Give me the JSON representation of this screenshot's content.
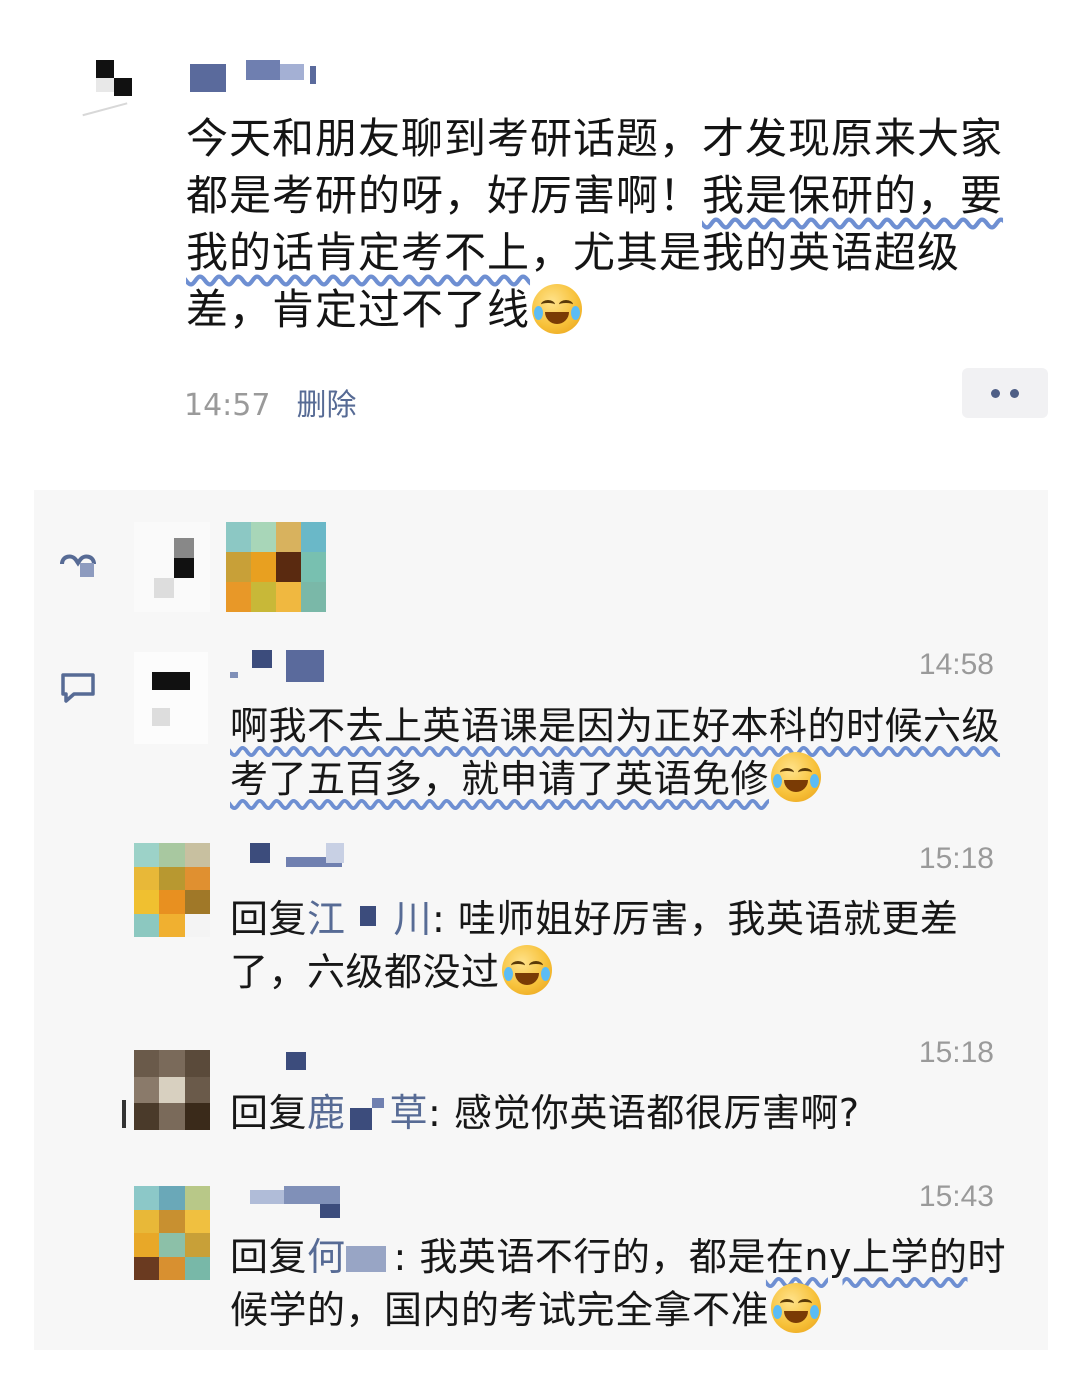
{
  "post": {
    "avatar_icon": "pixelated-avatar",
    "text_before": "今天和朋友聊到考研话题，才发现原来大家都是考研的呀，好厉害啊！",
    "text_under": "我是保研的，要我的话肯定考不上",
    "text_after": "，尤其是我的英语超级差，肯定过不了线",
    "emoji": "facepalm-emoji",
    "time": "14:57",
    "delete_label": "删除",
    "more_icon": "more-dots-icon"
  },
  "likes": {
    "icon": "like-icon"
  },
  "comments_icon": "comment-icon",
  "comments": [
    {
      "time": "14:58",
      "text_under": "啊我不去上英语课是因为正好本科的时候六级考了五百多，就申请了英语免修",
      "emoji": "tears-of-joy-emoji"
    },
    {
      "time": "15:18",
      "reply_label": "回复",
      "reply_to_fragment_1": "江",
      "reply_to_fragment_2": "川",
      "text": ": 哇师姐好厉害，我英语就更差了，六级都没过",
      "emoji": "facepalm-emoji"
    },
    {
      "time": "15:18",
      "reply_label": "回复",
      "reply_to_fragment_1": "鹿",
      "reply_to_fragment_2": "草",
      "text": ": 感觉你英语都很厉害啊?"
    },
    {
      "time": "15:43",
      "reply_label": "回复",
      "reply_to_fragment_1": "何",
      "reply_to_fragment_2": "",
      "text_before": ": 我英语不行的，都是",
      "text_under": "在ny上学的",
      "text_after": "时候学的，国内的考试完全拿不准",
      "emoji": "tears-of-joy-emoji"
    }
  ],
  "colors": {
    "link": "#576b95",
    "timestamp": "#9a9a9a",
    "panel_bg": "#f7f7f7"
  }
}
